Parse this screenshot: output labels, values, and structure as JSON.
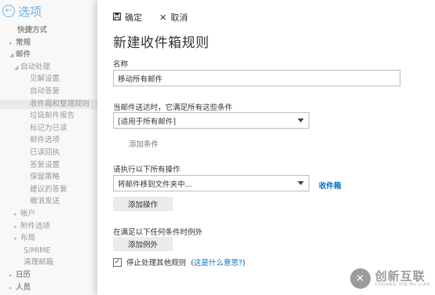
{
  "nav": {
    "title": "选项",
    "items": [
      {
        "label": "快捷方式",
        "level": 0,
        "tri": ""
      },
      {
        "label": "常规",
        "level": 0,
        "tri": "▸"
      },
      {
        "label": "邮件",
        "level": 0,
        "tri": "◢"
      },
      {
        "label": "自动处理",
        "level": 1,
        "tri": "◢"
      },
      {
        "label": "见解设置",
        "level": 2,
        "tri": ""
      },
      {
        "label": "自动答复",
        "level": 2,
        "tri": ""
      },
      {
        "label": "收件箱和整理规则",
        "level": 2,
        "tri": "",
        "selected": true
      },
      {
        "label": "垃圾邮件报告",
        "level": 2,
        "tri": ""
      },
      {
        "label": "标记为已读",
        "level": 2,
        "tri": ""
      },
      {
        "label": "邮件选项",
        "level": 2,
        "tri": ""
      },
      {
        "label": "已读回执",
        "level": 2,
        "tri": ""
      },
      {
        "label": "答复设置",
        "level": 2,
        "tri": ""
      },
      {
        "label": "保留策略",
        "level": 2,
        "tri": ""
      },
      {
        "label": "建议的答复",
        "level": 2,
        "tri": ""
      },
      {
        "label": "撤消发送",
        "level": 2,
        "tri": ""
      },
      {
        "label": "帐户",
        "level": 1,
        "tri": "▸"
      },
      {
        "label": "附件选项",
        "level": 1,
        "tri": "▸"
      },
      {
        "label": "布局",
        "level": 1,
        "tri": "▸"
      },
      {
        "label": "S/MIME",
        "level": 1,
        "tri": ""
      },
      {
        "label": "清理邮箱",
        "level": 1,
        "tri": ""
      },
      {
        "label": "日历",
        "level": 0,
        "tri": "▸"
      },
      {
        "label": "人员",
        "level": 0,
        "tri": "▸"
      }
    ]
  },
  "toolbar": {
    "save_label": "确定",
    "cancel_label": "取消"
  },
  "form": {
    "title": "新建收件箱规则",
    "name_label": "名称",
    "name_value": "移动所有邮件",
    "condition_label": "当邮件送达时，它满足所有这些条件",
    "condition_value": "[适用于所有邮件]",
    "add_condition": "添加条件",
    "action_label": "请执行以下所有操作",
    "action_value": "将邮件移到文件夹中...",
    "action_target": "收件箱",
    "add_action": "添加操作",
    "exception_label": "在满足以下任何条件时例外",
    "add_exception": "添加例外",
    "stop_label": "停止处理其他规则",
    "help_open": "(",
    "help_link": "这是什么意思?",
    "help_close": ")"
  },
  "watermark": {
    "cn": "创新互联",
    "en": "CHUANG XIN HU LIAN"
  }
}
